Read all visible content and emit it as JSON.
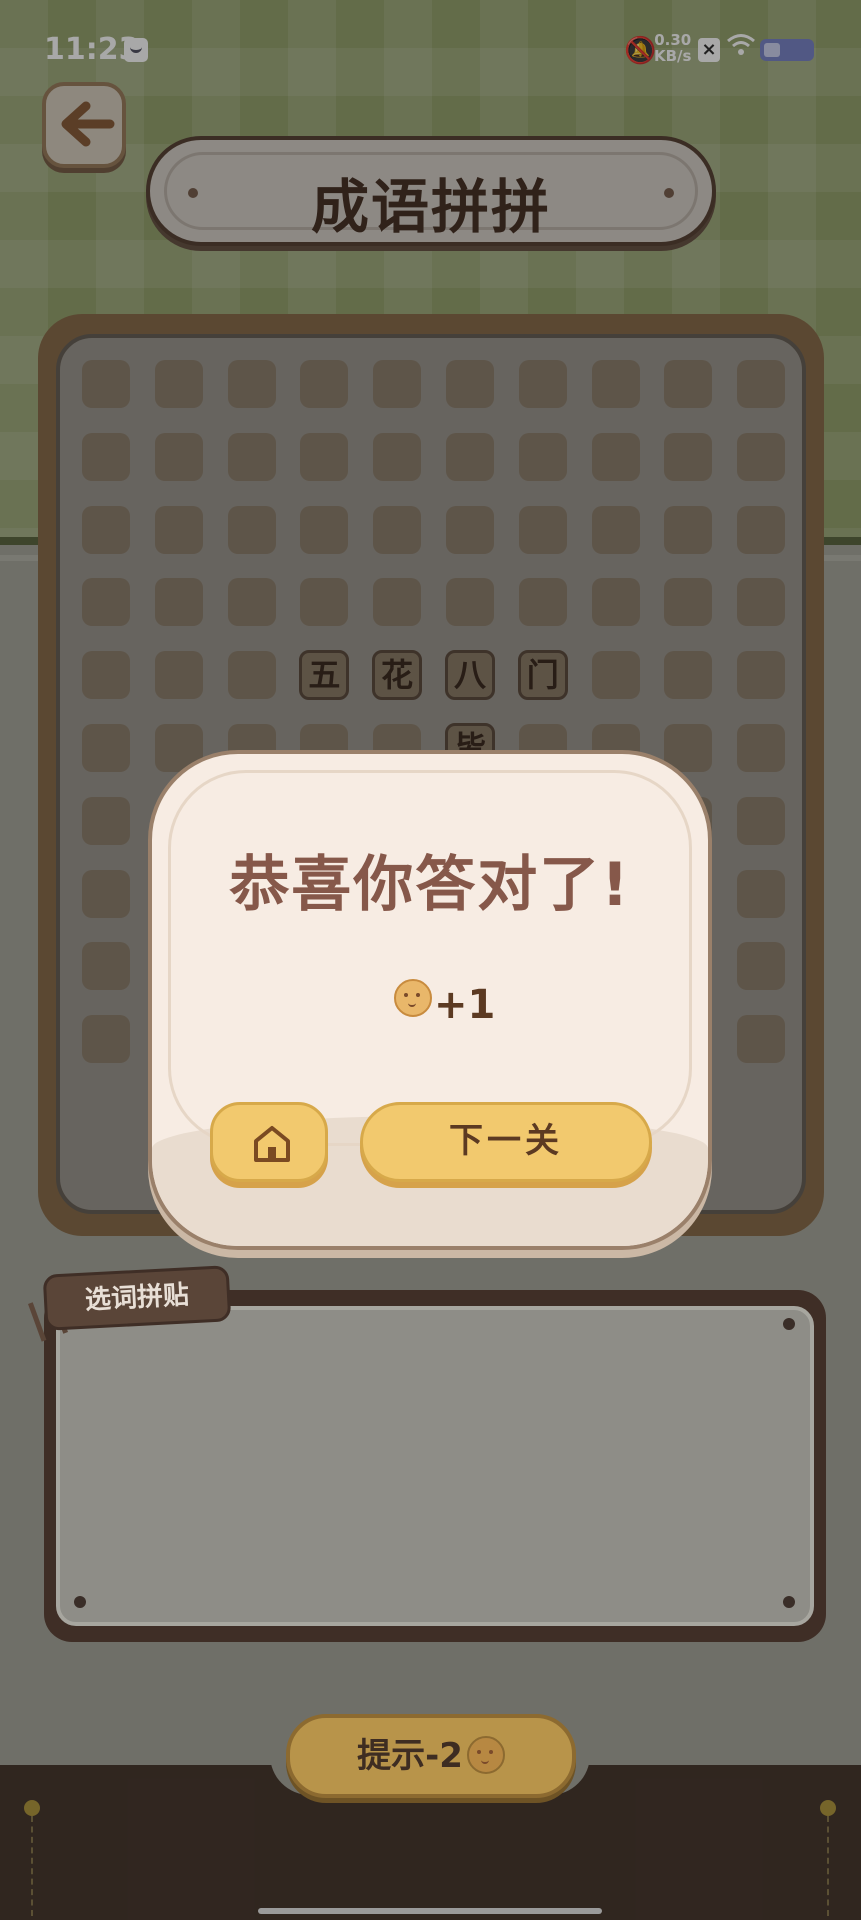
{
  "status_bar": {
    "time": "11:23",
    "network_speed_value": "0.30",
    "network_speed_unit": "KB/s"
  },
  "header": {
    "title": "成语拼拼"
  },
  "grid": {
    "placed_chars": [
      "五",
      "花",
      "八",
      "门"
    ],
    "partial_char": "皆"
  },
  "popup": {
    "heading": "恭喜你答对了!",
    "reward_amount": "+1",
    "next_label": "下一关"
  },
  "word_area": {
    "tag_label": "选词拼贴"
  },
  "hint": {
    "label": "提示-2"
  },
  "colors": {
    "accent_yellow": "#f2c96e",
    "wood_brown": "#5a4538",
    "heading_brown": "#86584a"
  },
  "icons": [
    "back-arrow-icon",
    "home-icon",
    "cookie-icon",
    "bell-off-icon",
    "wifi-icon",
    "battery-icon"
  ]
}
